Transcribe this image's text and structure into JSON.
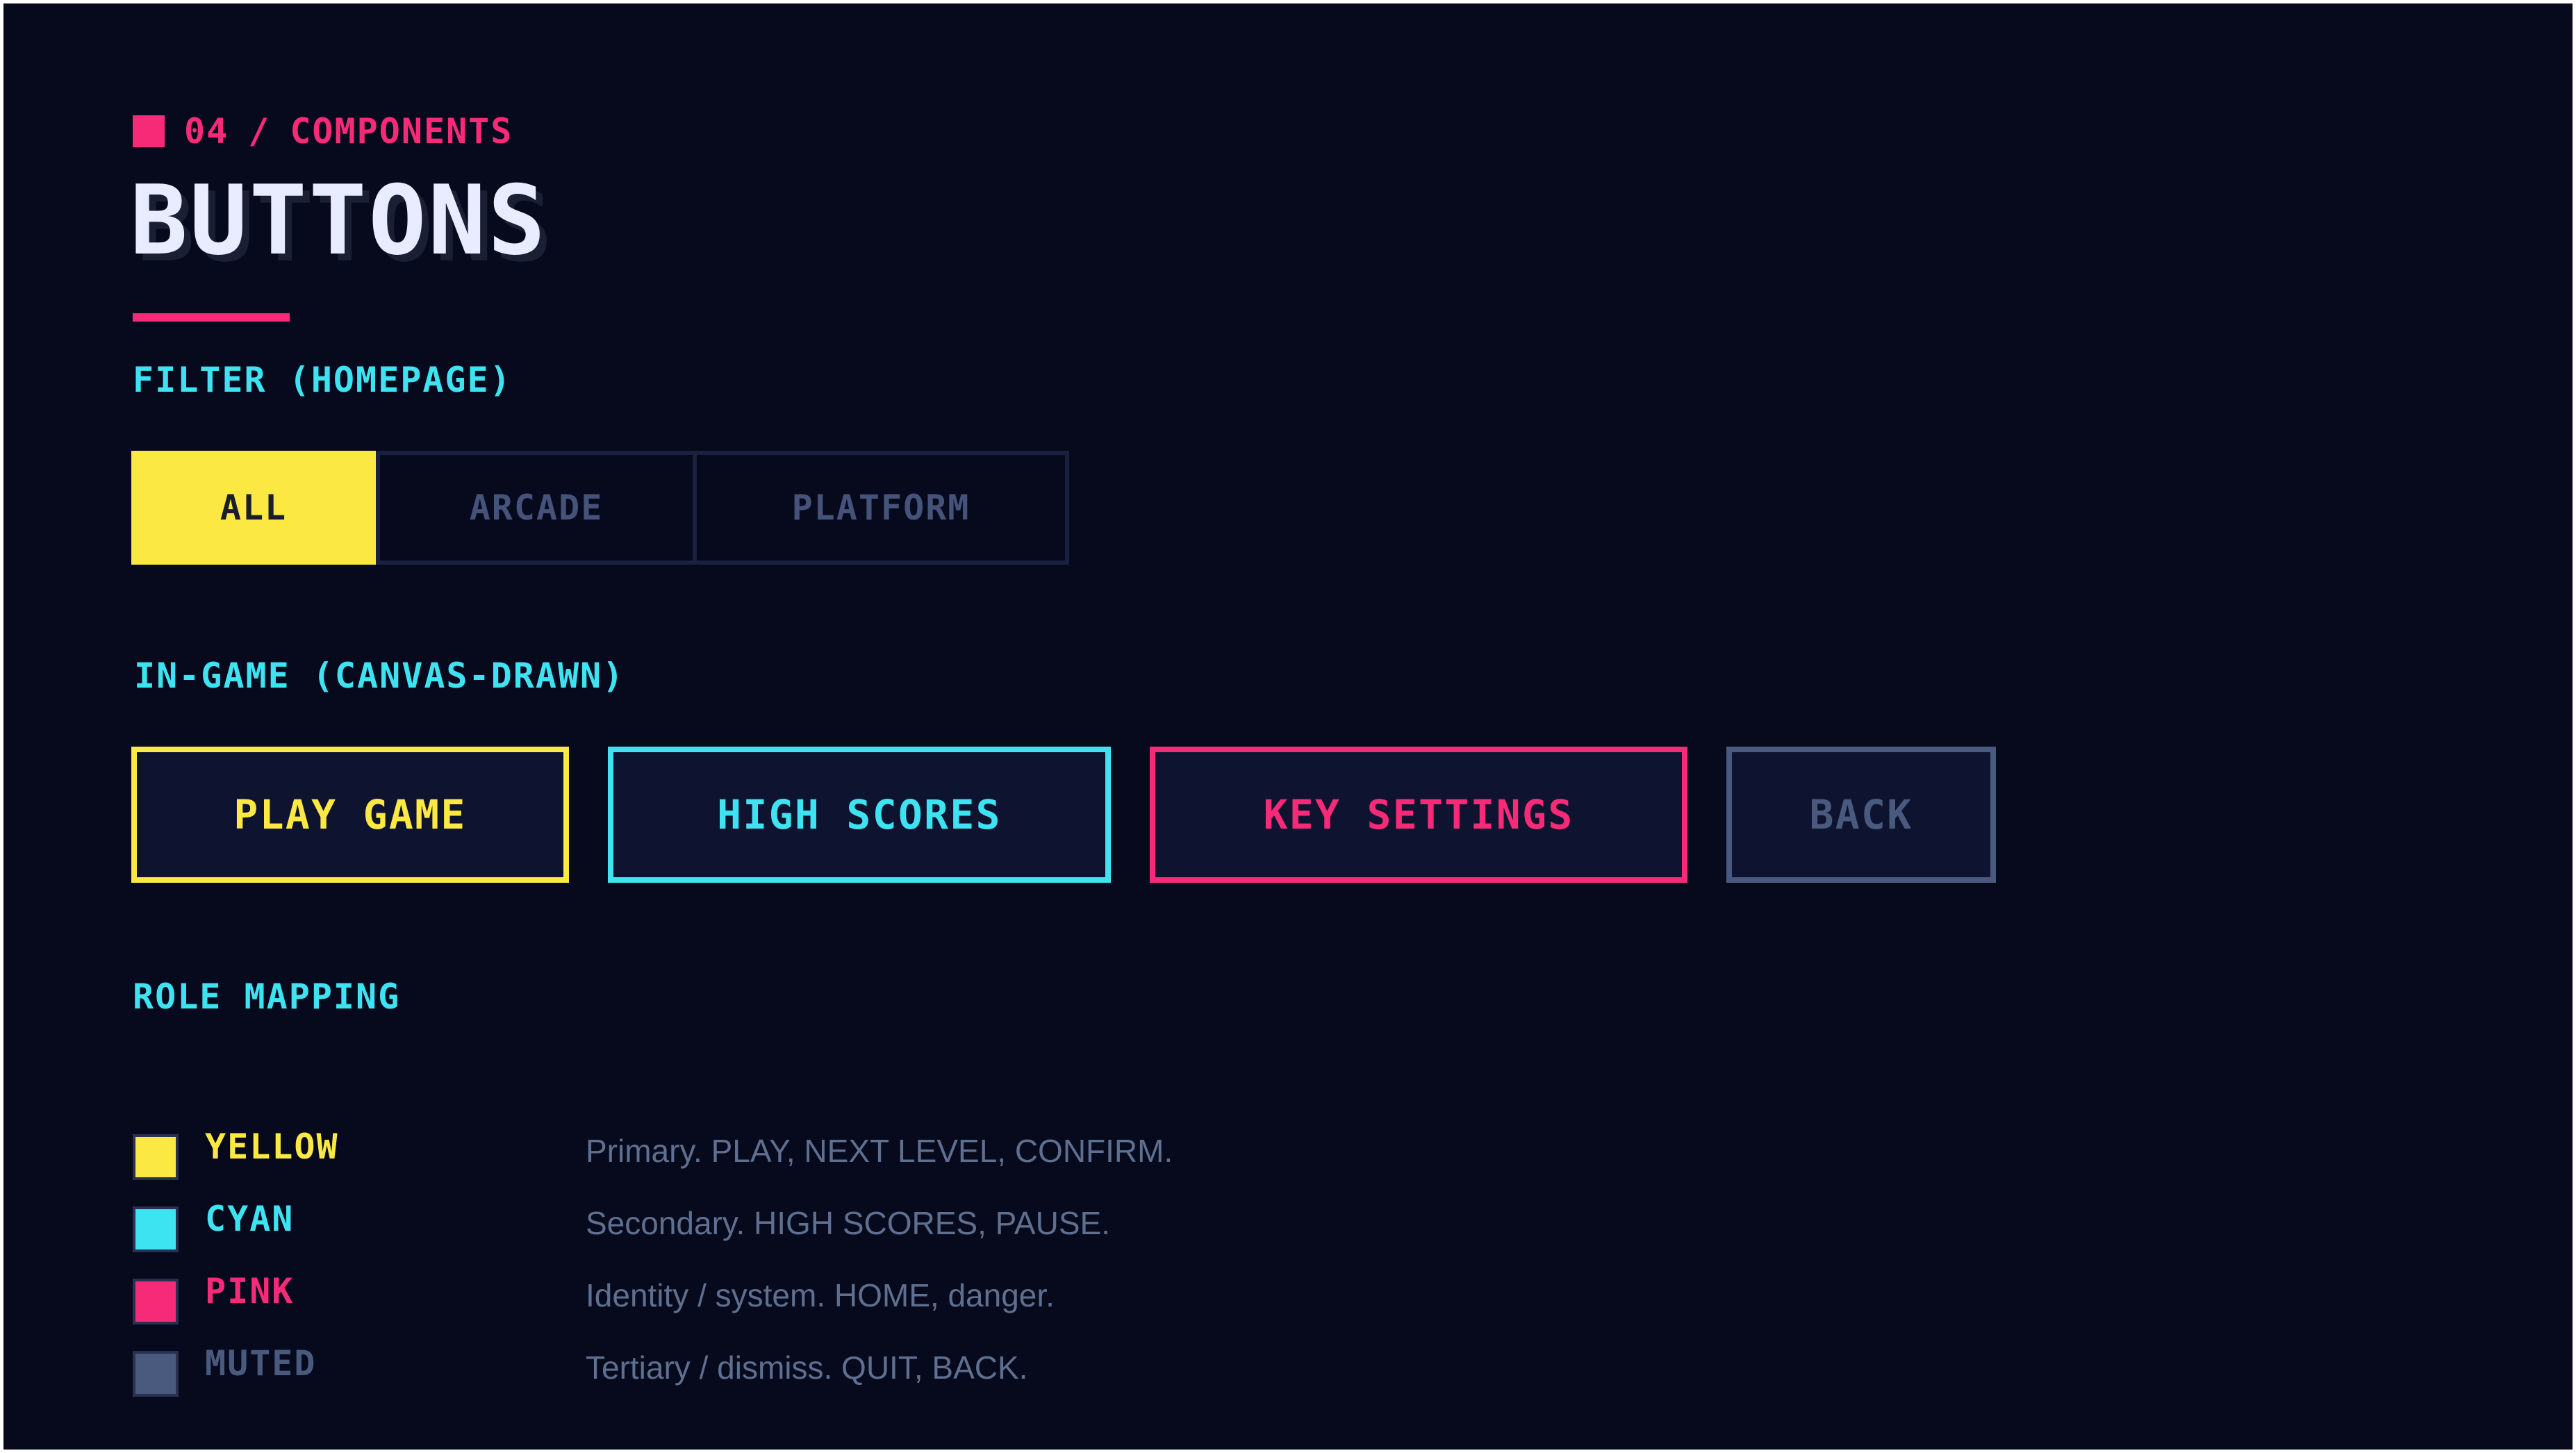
{
  "colors": {
    "background": "#060a1c",
    "yellow": "#fbe843",
    "cyan": "#3ee3f2",
    "pink": "#f72a78",
    "muted": "#4a5a7e",
    "title": "#e9ecff",
    "description": "#5f6f90",
    "inactive_filter_text": "#45527a"
  },
  "header": {
    "section_number": "04",
    "separator": "/",
    "section_name": "COMPONENTS",
    "title": "BUTTONS"
  },
  "filter_section": {
    "label": "FILTER (HOMEPAGE)",
    "buttons": [
      {
        "label": "ALL",
        "active": true
      },
      {
        "label": "ARCADE",
        "active": false
      },
      {
        "label": "PLATFORM",
        "active": false
      }
    ]
  },
  "ingame_section": {
    "label": "IN-GAME (CANVAS-DRAWN)",
    "buttons": [
      {
        "label": "PLAY GAME",
        "color": "yellow"
      },
      {
        "label": "HIGH SCORES",
        "color": "cyan"
      },
      {
        "label": "KEY SETTINGS",
        "color": "pink"
      },
      {
        "label": "BACK",
        "color": "muted"
      }
    ]
  },
  "role_section": {
    "label": "ROLE MAPPING",
    "roles": [
      {
        "name": "YELLOW",
        "description": "Primary. PLAY, NEXT LEVEL, CONFIRM.",
        "color": "yellow"
      },
      {
        "name": "CYAN",
        "description": "Secondary. HIGH SCORES, PAUSE.",
        "color": "cyan"
      },
      {
        "name": "PINK",
        "description": "Identity / system. HOME, danger.",
        "color": "pink"
      },
      {
        "name": "MUTED",
        "description": "Tertiary / dismiss. QUIT, BACK.",
        "color": "muted"
      }
    ]
  }
}
